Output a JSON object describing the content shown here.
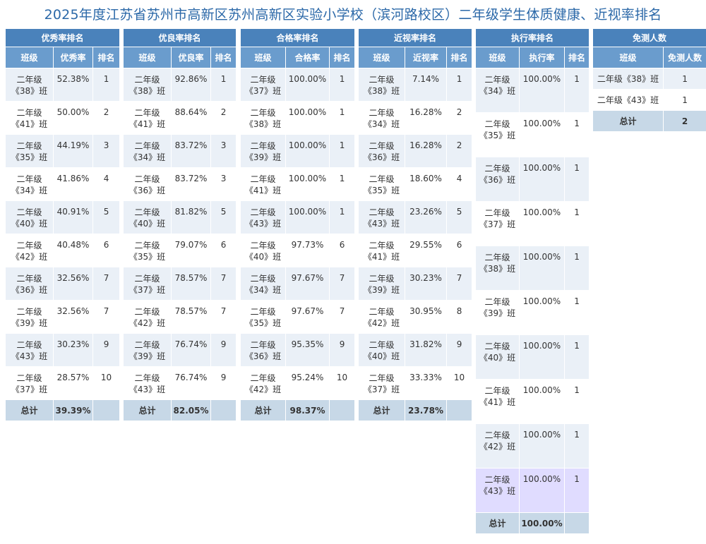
{
  "title": "2025年度江苏省苏州市高新区苏州高新区实验小学校（滨河路校区）二年级学生体质健康、近视率排名",
  "tables": {
    "excellent": {
      "title": "优秀率排名",
      "headers": [
        "班级",
        "优秀率",
        "排名"
      ],
      "rows": [
        {
          "cls": "二年级《38》班",
          "val": "52.38%",
          "rank": "1"
        },
        {
          "cls": "二年级《41》班",
          "val": "50.00%",
          "rank": "2"
        },
        {
          "cls": "二年级《35》班",
          "val": "44.19%",
          "rank": "3"
        },
        {
          "cls": "二年级《34》班",
          "val": "41.86%",
          "rank": "4"
        },
        {
          "cls": "二年级《40》班",
          "val": "40.91%",
          "rank": "5"
        },
        {
          "cls": "二年级《42》班",
          "val": "40.48%",
          "rank": "6"
        },
        {
          "cls": "二年级《36》班",
          "val": "32.56%",
          "rank": "7"
        },
        {
          "cls": "二年级《39》班",
          "val": "32.56%",
          "rank": "7"
        },
        {
          "cls": "二年级《43》班",
          "val": "30.23%",
          "rank": "9"
        },
        {
          "cls": "二年级《37》班",
          "val": "28.57%",
          "rank": "10"
        }
      ],
      "total_label": "总计",
      "total_value": "39.39%"
    },
    "good": {
      "title": "优良率排名",
      "headers": [
        "班级",
        "优良率",
        "排名"
      ],
      "rows": [
        {
          "cls": "二年级《38》班",
          "val": "92.86%",
          "rank": "1"
        },
        {
          "cls": "二年级《41》班",
          "val": "88.64%",
          "rank": "2"
        },
        {
          "cls": "二年级《34》班",
          "val": "83.72%",
          "rank": "3"
        },
        {
          "cls": "二年级《36》班",
          "val": "83.72%",
          "rank": "3"
        },
        {
          "cls": "二年级《40》班",
          "val": "81.82%",
          "rank": "5"
        },
        {
          "cls": "二年级《35》班",
          "val": "79.07%",
          "rank": "6"
        },
        {
          "cls": "二年级《37》班",
          "val": "78.57%",
          "rank": "7"
        },
        {
          "cls": "二年级《42》班",
          "val": "78.57%",
          "rank": "7"
        },
        {
          "cls": "二年级《39》班",
          "val": "76.74%",
          "rank": "9"
        },
        {
          "cls": "二年级《43》班",
          "val": "76.74%",
          "rank": "9"
        }
      ],
      "total_label": "总计",
      "total_value": "82.05%"
    },
    "pass": {
      "title": "合格率排名",
      "headers": [
        "班级",
        "合格率",
        "排名"
      ],
      "rows": [
        {
          "cls": "二年级《37》班",
          "val": "100.00%",
          "rank": "1"
        },
        {
          "cls": "二年级《38》班",
          "val": "100.00%",
          "rank": "1"
        },
        {
          "cls": "二年级《39》班",
          "val": "100.00%",
          "rank": "1"
        },
        {
          "cls": "二年级《41》班",
          "val": "100.00%",
          "rank": "1"
        },
        {
          "cls": "二年级《43》班",
          "val": "100.00%",
          "rank": "1"
        },
        {
          "cls": "二年级《40》班",
          "val": "97.73%",
          "rank": "6"
        },
        {
          "cls": "二年级《34》班",
          "val": "97.67%",
          "rank": "7"
        },
        {
          "cls": "二年级《35》班",
          "val": "97.67%",
          "rank": "7"
        },
        {
          "cls": "二年级《36》班",
          "val": "95.35%",
          "rank": "9"
        },
        {
          "cls": "二年级《42》班",
          "val": "95.24%",
          "rank": "10"
        }
      ],
      "total_label": "总计",
      "total_value": "98.37%"
    },
    "myopia": {
      "title": "近视率排名",
      "headers": [
        "班级",
        "近视率",
        "排名"
      ],
      "rows": [
        {
          "cls": "二年级《38》班",
          "val": "7.14%",
          "rank": "1"
        },
        {
          "cls": "二年级《34》班",
          "val": "16.28%",
          "rank": "2"
        },
        {
          "cls": "二年级《36》班",
          "val": "16.28%",
          "rank": "2"
        },
        {
          "cls": "二年级《35》班",
          "val": "18.60%",
          "rank": "4"
        },
        {
          "cls": "二年级《43》班",
          "val": "23.26%",
          "rank": "5"
        },
        {
          "cls": "二年级《41》班",
          "val": "29.55%",
          "rank": "6"
        },
        {
          "cls": "二年级《39》班",
          "val": "30.23%",
          "rank": "7"
        },
        {
          "cls": "二年级《42》班",
          "val": "30.95%",
          "rank": "8"
        },
        {
          "cls": "二年级《40》班",
          "val": "31.82%",
          "rank": "9"
        },
        {
          "cls": "二年级《37》班",
          "val": "33.33%",
          "rank": "10"
        }
      ],
      "total_label": "总计",
      "total_value": "23.78%"
    },
    "execution": {
      "title": "执行率排名",
      "headers": [
        "班级",
        "执行率",
        "排名"
      ],
      "rows": [
        {
          "cls": "二年级《34》班",
          "val": "100.00%",
          "rank": "1"
        },
        {
          "cls": "二年级《35》班",
          "val": "100.00%",
          "rank": "1"
        },
        {
          "cls": "二年级《36》班",
          "val": "100.00%",
          "rank": "1"
        },
        {
          "cls": "二年级《37》班",
          "val": "100.00%",
          "rank": "1"
        },
        {
          "cls": "二年级《38》班",
          "val": "100.00%",
          "rank": "1"
        },
        {
          "cls": "二年级《39》班",
          "val": "100.00%",
          "rank": "1"
        },
        {
          "cls": "二年级《40》班",
          "val": "100.00%",
          "rank": "1"
        },
        {
          "cls": "二年级《41》班",
          "val": "100.00%",
          "rank": "1"
        },
        {
          "cls": "二年级《42》班",
          "val": "100.00%",
          "rank": "1"
        },
        {
          "cls": "二年级《43》班",
          "val": "100.00%",
          "rank": "1"
        }
      ],
      "total_label": "总计",
      "total_value": "100.00%"
    },
    "exempt": {
      "title": "免测人数",
      "headers": [
        "班级",
        "免测人数"
      ],
      "rows": [
        {
          "cls": "二年级《38》班",
          "count": "1"
        },
        {
          "cls": "二年级《43》班",
          "count": "1"
        }
      ],
      "total_label": "总计",
      "total_value": "2"
    }
  },
  "colors": {
    "title_text": "#2b68a8",
    "table_title_bg": "#4a82bb",
    "header_bg": "#6a9ccd",
    "row_alt_bg": "#eaf0f7",
    "total_bg": "#c7d8e7",
    "highlight_bg": "#e0dcff"
  }
}
